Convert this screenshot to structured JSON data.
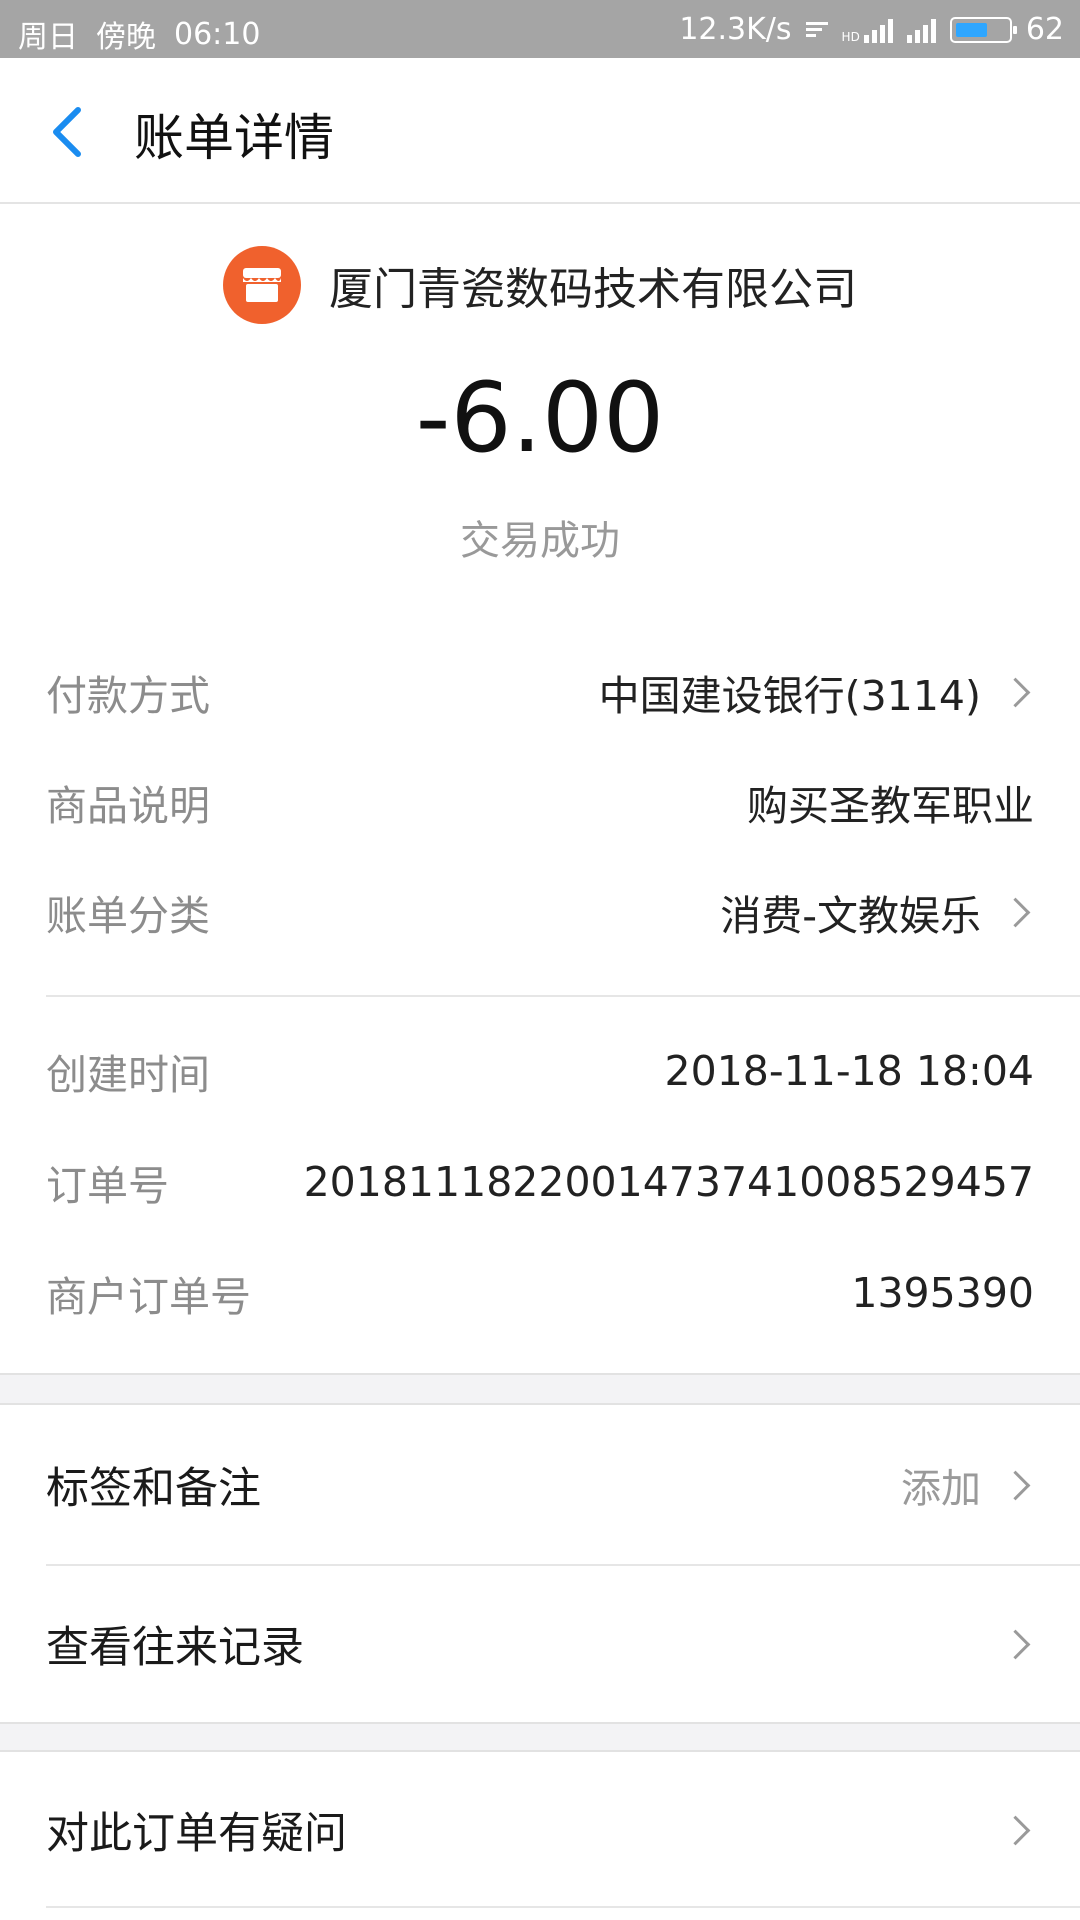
{
  "status_bar": {
    "day": "周日",
    "period": "傍晚",
    "time": "06:10",
    "net_speed": "12.3K/s",
    "hd_label": "HD",
    "battery": "62",
    "battery_level": 0.62
  },
  "header": {
    "title": "账单详情"
  },
  "merchant": {
    "name": "厦门青瓷数码技术有限公司",
    "icon": "shop-icon",
    "icon_color": "#f0612d"
  },
  "amount": "-6.00",
  "transaction_status": "交易成功",
  "details": [
    {
      "label": "付款方式",
      "value": "中国建设银行(3114)"
    },
    {
      "label": "商品说明",
      "value": "购买圣教军职业"
    },
    {
      "label": "账单分类",
      "value": "消费-文教娱乐"
    },
    {
      "label": "创建时间",
      "value": "2018-11-18 18:04"
    },
    {
      "label": "订单号",
      "value": "2018111822001473741008529457"
    },
    {
      "label": "商户订单号",
      "value": "1395390"
    }
  ],
  "actions": {
    "tags": {
      "label": "标签和备注",
      "hint": "添加"
    },
    "history": {
      "label": "查看往来记录"
    },
    "question": {
      "label": "对此订单有疑问"
    }
  },
  "colors": {
    "accent": "#1a8cf0",
    "status_bar": "#a5a5a5"
  }
}
